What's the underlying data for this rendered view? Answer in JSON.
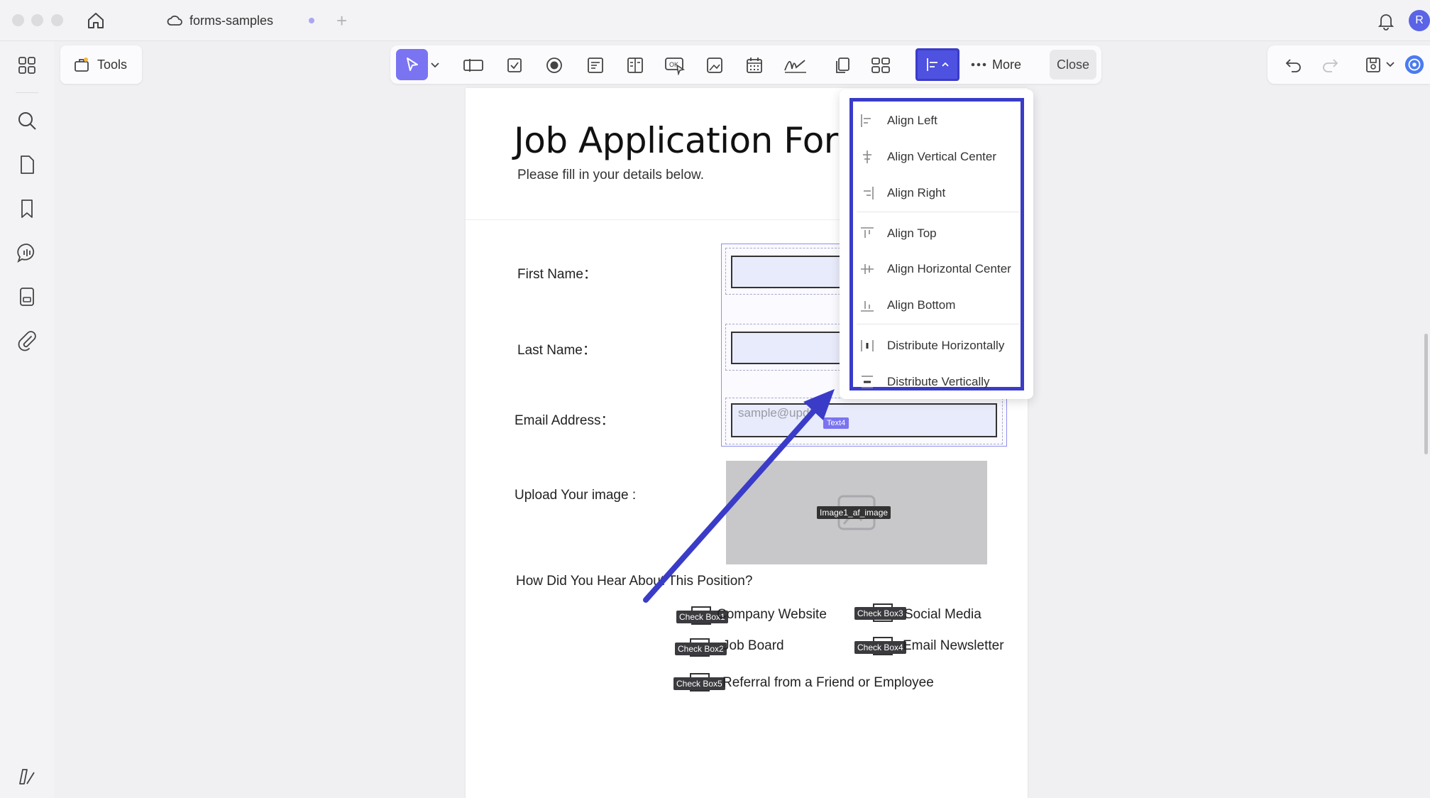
{
  "window": {
    "tab_title": "forms-samples",
    "avatar_initial": "R"
  },
  "tools_chip": {
    "label": "Tools"
  },
  "toolbar": {
    "more_label": "More",
    "close_label": "Close"
  },
  "document": {
    "title": "Job Application Form",
    "subtitle": "Please fill in your details below.",
    "labels": {
      "first_name": "First Name：",
      "last_name": "Last Name：",
      "email": "Email Address：",
      "upload": "Upload Your image :",
      "how_did_you_hear": "How Did You Hear About This Position?"
    },
    "email_placeholder": "sample@updf",
    "email_field_tag": "Text4",
    "image_field_tag": "Image1_af_image",
    "checkboxes": [
      {
        "tag": "Check Box1",
        "text": "Company Website"
      },
      {
        "tag": "Check Box2",
        "text": "Job Board"
      },
      {
        "tag": "Check Box3",
        "text": "Social Media"
      },
      {
        "tag": "Check Box4",
        "text": "Email Newsletter"
      },
      {
        "tag": "Check Box5",
        "text": "Referral from a Friend or Employee"
      }
    ]
  },
  "align_menu": {
    "items": [
      {
        "label": "Align Left",
        "icon": "align-left-icon"
      },
      {
        "label": "Align Vertical Center",
        "icon": "align-vertical-center-icon"
      },
      {
        "label": "Align Right",
        "icon": "align-right-icon"
      },
      {
        "label": "Align Top",
        "icon": "align-top-icon"
      },
      {
        "label": "Align Horizontal Center",
        "icon": "align-horizontal-center-icon"
      },
      {
        "label": "Align Bottom",
        "icon": "align-bottom-icon"
      },
      {
        "label": "Distribute Horizontally",
        "icon": "distribute-horizontally-icon"
      },
      {
        "label": "Distribute Vertically",
        "icon": "distribute-vertically-icon"
      }
    ]
  },
  "colors": {
    "accent": "#7a74f3",
    "highlight": "#3a3cc8",
    "field_fill": "#e8ebfb"
  }
}
